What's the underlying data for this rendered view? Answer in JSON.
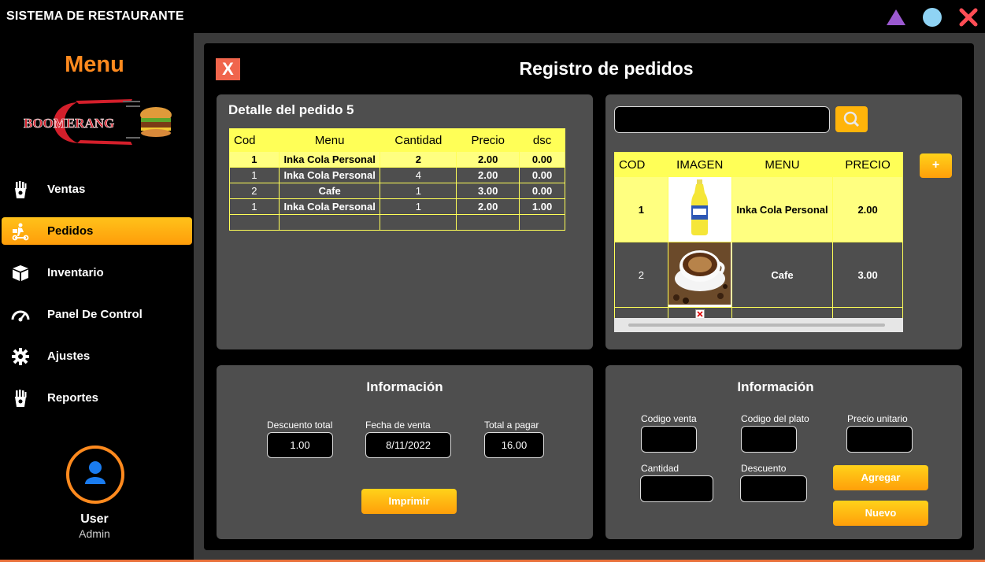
{
  "app": {
    "title": "SISTEMA DE RESTAURANTE"
  },
  "colors": {
    "accent": "#ff8a1e",
    "button": "#ffb40a",
    "grid_header": "#ffff57",
    "grid_selected": "#ffff80",
    "panel": "#4e4e4e",
    "close": "#f0654c",
    "purple_ctrl": "#9b59d0",
    "cyan_ctrl": "#8fd3f4",
    "red_ctrl": "#ff4d55"
  },
  "sidebar": {
    "title": "Menu",
    "logo_text": "BOOMERANG",
    "items": [
      {
        "label": "Ventas",
        "icon": "fries-icon"
      },
      {
        "label": "Pedidos",
        "icon": "delivery-icon",
        "active": true
      },
      {
        "label": "Inventario",
        "icon": "box-icon"
      },
      {
        "label": "Panel De Control",
        "icon": "gauge-icon"
      },
      {
        "label": "Ajustes",
        "icon": "gear-icon"
      },
      {
        "label": "Reportes",
        "icon": "fries-icon"
      }
    ],
    "user": {
      "name": "User",
      "role": "Admin"
    }
  },
  "main": {
    "close_label": "X",
    "title": "Registro de pedidos",
    "detail": {
      "title": "Detalle del pedido",
      "order_number": "5",
      "columns": [
        "Cod",
        "Menu",
        "Cantidad",
        "Precio",
        "dsc"
      ],
      "rows": [
        [
          "1",
          "Inka Cola Personal",
          "2",
          "2.00",
          "0.00"
        ],
        [
          "1",
          "Inka Cola Personal",
          "4",
          "2.00",
          "0.00"
        ],
        [
          "2",
          "Cafe",
          "1",
          "3.00",
          "0.00"
        ],
        [
          "1",
          "Inka Cola Personal",
          "1",
          "2.00",
          "1.00"
        ]
      ]
    },
    "catalog": {
      "search_value": "",
      "add_label": "+",
      "columns": [
        "COD",
        "IMAGEN",
        "MENU",
        "PRECIO"
      ],
      "rows": [
        {
          "cod": "1",
          "image": "bottle-image",
          "menu": "Inka Cola Personal",
          "precio": "2.00"
        },
        {
          "cod": "2",
          "image": "coffee-image",
          "menu": "Cafe",
          "precio": "3.00"
        }
      ]
    },
    "info_left": {
      "title": "Información",
      "descuento_label": "Descuento total",
      "descuento_value": "1.00",
      "fecha_label": "Fecha de venta",
      "fecha_value": "8/11/2022",
      "total_label": "Total a pagar",
      "total_value": "16.00",
      "print_label": "Imprimir"
    },
    "info_right": {
      "title": "Información",
      "codigo_venta_label": "Codigo venta",
      "codigo_plato_label": "Codigo del plato",
      "precio_unitario_label": "Precio unitario",
      "cantidad_label": "Cantidad",
      "descuento_label": "Descuento",
      "agregar_label": "Agregar",
      "nuevo_label": "Nuevo"
    }
  }
}
